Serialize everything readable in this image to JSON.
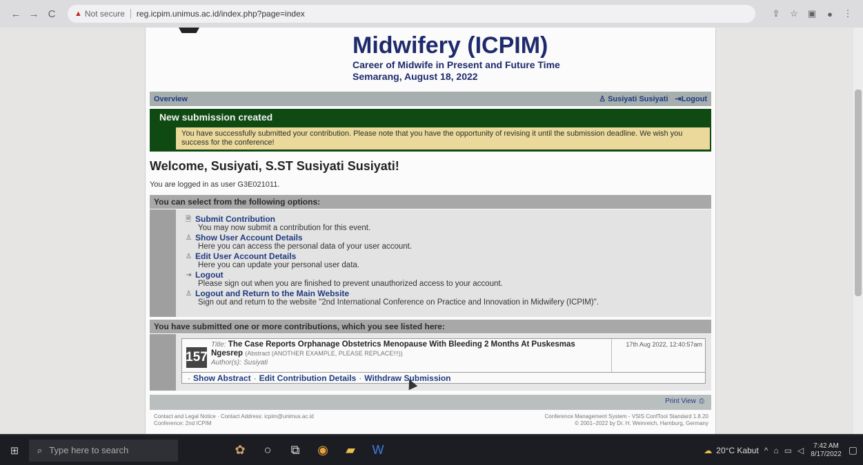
{
  "browser": {
    "security_label": "Not secure",
    "url": "reg.icpim.unimus.ac.id/index.php?page=index"
  },
  "event": {
    "title": "Midwifery (ICPIM)",
    "theme": "Career of Midwife in Present and Future Time",
    "date_place": "Semarang, August 18, 2022"
  },
  "nav": {
    "overview": "Overview",
    "user": "Susiyati Susiyati",
    "logout": "Logout"
  },
  "notice": {
    "title": "New submission created",
    "message": "You have successfully submitted your contribution. Please note that you have the opportunity of revising it until the submission deadline. We wish you success for the conference!"
  },
  "welcome": {
    "heading": "Welcome, Susiyati, S.ST Susiyati Susiyati!",
    "logged_in": "You are logged in as user G3E021011."
  },
  "options": {
    "header": "You can select from the following options:",
    "items": [
      {
        "label": "Submit Contribution",
        "desc": "You may now submit a contribution for this event.",
        "icon": "document-icon"
      },
      {
        "label": "Show User Account Details",
        "desc": "Here you can access the personal data of your user account.",
        "icon": "user-view-icon"
      },
      {
        "label": "Edit User Account Details",
        "desc": "Here you can update your personal user data.",
        "icon": "user-edit-icon"
      },
      {
        "label": "Logout",
        "desc": "Please sign out when you are finished to prevent unauthorized access to your account.",
        "icon": "logout-icon"
      },
      {
        "label": "Logout and Return to the Main Website",
        "desc": "Sign out and return to the website \"2nd International Conference on Practice and Innovation in Midwifery (ICPIM)\".",
        "icon": "logout-return-icon"
      }
    ]
  },
  "submissions": {
    "header": "You have submitted one or more contributions, which you see listed here:",
    "item": {
      "id": "157",
      "title_label": "Title:",
      "title": "The Case Reports Orphanage Obstetrics Menopause With Bleeding 2 Months At Puskesmas Ngesrep",
      "abstract_note": "(Abstract (ANOTHER EXAMPLE, PLEASE REPLACE!!!))",
      "author_label": "Author(s):",
      "author": "Susiyati",
      "date": "17th Aug 2022, 12:40:57am"
    },
    "actions": [
      "Show Abstract",
      "Edit Contribution Details",
      "Withdraw Submission"
    ]
  },
  "footer": {
    "print_view": "Print View",
    "left_line1": "Contact and Legal Notice · Contact Address: icpim@unimus.ac.id",
    "left_line2": "Conference: 2nd ICPIM",
    "right_line1": "Conference Management System - VSIS ConfTool Standard 1.8.20",
    "right_line2": "© 2001–2022 by Dr. H. Weinreich, Hamburg, Germany"
  },
  "taskbar": {
    "search_placeholder": "Type here to search",
    "weather": "20°C Kabut",
    "time": "7:42 AM",
    "date": "8/17/2022"
  }
}
